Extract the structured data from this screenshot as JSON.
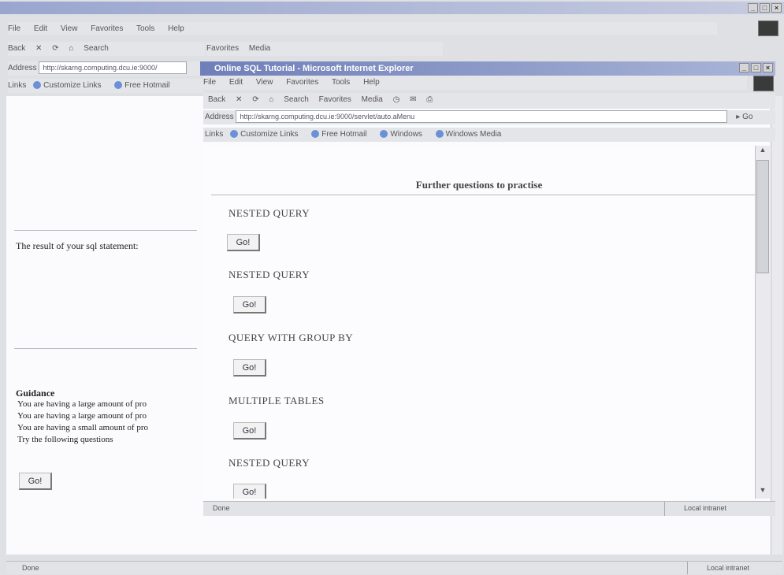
{
  "back_window": {
    "menu": [
      "File",
      "Edit",
      "View",
      "Favorites",
      "Tools",
      "Help"
    ],
    "toolbar": [
      "Back",
      "Search",
      "Favorites",
      "Media"
    ],
    "address_label": "Address",
    "address_value": "http://skarng.computing.dcu.ie:9000/",
    "links_label": "Links",
    "links": [
      "Customize Links",
      "Free Hotmail"
    ],
    "result_text": "The result of your sql statement:",
    "guidance_title": "Guidance",
    "guidance_items": [
      "You are having a large amount of pro",
      "You are having a large amount of pro",
      "You are having a small amount of pro",
      "Try the following questions"
    ],
    "go_label": "Go!",
    "status_left": "Done",
    "status_zone": "Local intranet"
  },
  "front_window": {
    "title": "Online SQL Tutorial - Microsoft Internet Explorer",
    "menu": [
      "File",
      "Edit",
      "View",
      "Favorites",
      "Tools",
      "Help"
    ],
    "toolbar": [
      "Back",
      "Search",
      "Favorites",
      "Media"
    ],
    "address_label": "Address",
    "address_value": "http://skarng.computing.dcu.ie:9000/servlet/auto.aMenu",
    "go_arrow_label": "Go",
    "links_label": "Links",
    "links": [
      "Customize Links",
      "Free Hotmail",
      "Windows",
      "Windows Media"
    ],
    "heading": "Further questions to practise",
    "questions": [
      {
        "label": "NESTED QUERY",
        "button": "Go!"
      },
      {
        "label": "NESTED QUERY",
        "button": "Go!"
      },
      {
        "label": "QUERY WITH GROUP BY",
        "button": "Go!"
      },
      {
        "label": "MULTIPLE TABLES",
        "button": "Go!"
      },
      {
        "label": "NESTED QUERY",
        "button": "Go!"
      }
    ],
    "status_left": "Done",
    "status_zone": "Local intranet"
  },
  "icons": {
    "window_controls": [
      "minimize-icon",
      "maximize-icon",
      "close-icon"
    ]
  }
}
